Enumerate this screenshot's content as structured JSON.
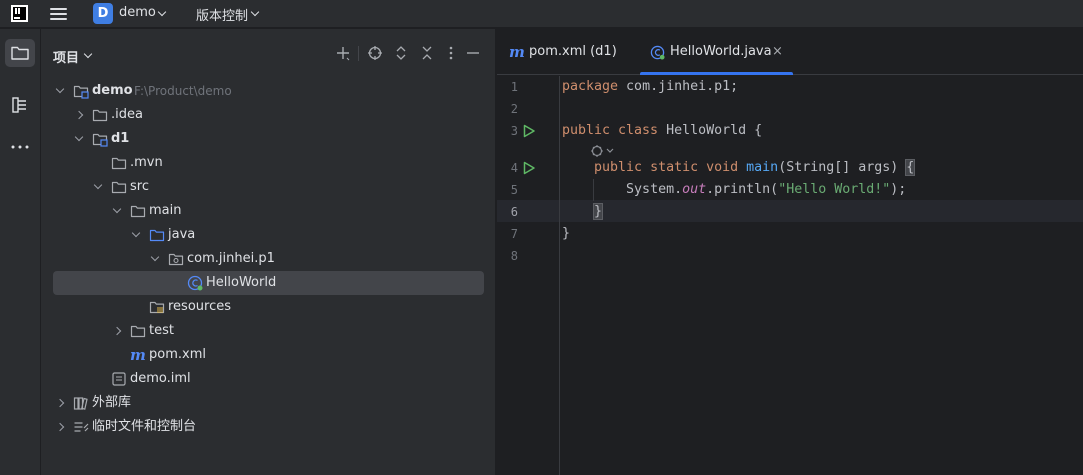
{
  "titlebar": {
    "project_badge": "D",
    "project_name": "demo",
    "vcs_label": "版本控制"
  },
  "toolstrip": {
    "items": [
      {
        "name": "project",
        "icon": "folder-icon",
        "active": true
      },
      {
        "name": "structure",
        "icon": "structure-icon",
        "active": false
      },
      {
        "name": "more",
        "icon": "more-icon",
        "active": false
      }
    ]
  },
  "project_panel": {
    "title": "项目",
    "actions": [
      "add-icon",
      "locate-icon",
      "expand-all-icon",
      "collapse-all-icon",
      "options-icon",
      "hide-icon"
    ],
    "tree": [
      {
        "label": "demo",
        "path": "F:\\Product\\demo",
        "depth": 0,
        "expanded": true,
        "icon": "module-folder-icon",
        "bold": true
      },
      {
        "label": ".idea",
        "depth": 1,
        "expanded": false,
        "icon": "folder-icon"
      },
      {
        "label": "d1",
        "depth": 1,
        "expanded": true,
        "icon": "module-folder-icon",
        "bold": true
      },
      {
        "label": ".mvn",
        "depth": 2,
        "icon": "folder-icon"
      },
      {
        "label": "src",
        "depth": 2,
        "expanded": true,
        "icon": "folder-icon"
      },
      {
        "label": "main",
        "depth": 3,
        "expanded": true,
        "icon": "folder-icon"
      },
      {
        "label": "java",
        "depth": 4,
        "expanded": true,
        "icon": "source-folder-icon"
      },
      {
        "label": "com.jinhei.p1",
        "depth": 5,
        "expanded": true,
        "icon": "package-icon"
      },
      {
        "label": "HelloWorld",
        "depth": 6,
        "icon": "java-class-icon",
        "selected": true
      },
      {
        "label": "resources",
        "depth": 4,
        "icon": "resources-folder-icon"
      },
      {
        "label": "test",
        "depth": 3,
        "expanded": false,
        "icon": "folder-icon"
      },
      {
        "label": "pom.xml",
        "depth": 3,
        "icon": "maven-icon"
      },
      {
        "label": "demo.iml",
        "depth": 2,
        "icon": "iml-file-icon"
      },
      {
        "label": "外部库",
        "depth": 0,
        "expanded": false,
        "icon": "library-icon"
      },
      {
        "label": "临时文件和控制台",
        "depth": 0,
        "expanded": false,
        "icon": "scratches-icon"
      }
    ]
  },
  "editor": {
    "tabs": [
      {
        "label": "pom.xml (d1)",
        "icon": "maven-icon",
        "active": false
      },
      {
        "label": "HelloWorld.java",
        "icon": "java-class-icon",
        "active": true,
        "close": "×"
      }
    ],
    "line_numbers": [
      "1",
      "2",
      "3",
      "4",
      "5",
      "6",
      "7",
      "8"
    ],
    "current_line": 6,
    "run_lines": [
      3,
      4
    ],
    "code": {
      "l1_kw": "package",
      "l1_rest": " com.jinhei.p1;",
      "l3_kw": "public class",
      "l3_rest": " HelloWorld {",
      "l4_kw": "public static void",
      "l4_fn": "main",
      "l4_rest": "(String[] args) ",
      "l4_brace": "{",
      "l5_pre": "System.",
      "l5_it": "out",
      "l5_mid": ".println(",
      "l5_str": "\"Hello World!\"",
      "l5_end": ");",
      "l6": "}",
      "l7": "}"
    }
  },
  "colors": {
    "accent": "#3574f0",
    "keyword": "#cf8e6d",
    "function": "#56a8f5",
    "string": "#6aab73",
    "static_field": "#c77dbb",
    "run_green": "#5fb865"
  }
}
